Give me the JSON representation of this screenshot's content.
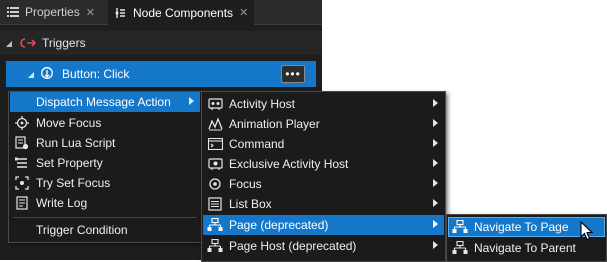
{
  "tabs": [
    {
      "label": "Properties",
      "icon": "list-icon",
      "close": "✕"
    },
    {
      "label": "Node Components",
      "icon": "node-components-icon",
      "close": "✕"
    }
  ],
  "tree": {
    "triggers_label": "Triggers",
    "button_label": "Button: Click",
    "more_label": "•••"
  },
  "menu1": {
    "items": [
      {
        "label": "Dispatch Message Action",
        "icon": "",
        "submenu": true
      },
      {
        "label": "Move Focus",
        "icon": "move-focus-icon"
      },
      {
        "label": "Run Lua Script",
        "icon": "lua-script-icon"
      },
      {
        "label": "Set Property",
        "icon": "set-property-icon"
      },
      {
        "label": "Try Set Focus",
        "icon": "try-set-focus-icon"
      },
      {
        "label": "Write Log",
        "icon": "write-log-icon"
      }
    ],
    "trigger_condition": "Trigger Condition"
  },
  "menu2": {
    "items": [
      {
        "label": "Activity Host",
        "icon": "activity-host-icon"
      },
      {
        "label": "Animation Player",
        "icon": "animation-player-icon"
      },
      {
        "label": "Command",
        "icon": "command-icon"
      },
      {
        "label": "Exclusive Activity Host",
        "icon": "exclusive-activity-host-icon"
      },
      {
        "label": "Focus",
        "icon": "focus-icon"
      },
      {
        "label": "List Box",
        "icon": "list-box-icon"
      },
      {
        "label": "Page (deprecated)",
        "icon": "page-icon"
      },
      {
        "label": "Page Host (deprecated)",
        "icon": "page-host-icon"
      }
    ]
  },
  "menu3": {
    "items": [
      {
        "label": "Navigate To Page",
        "icon": "navigate-icon"
      },
      {
        "label": "Navigate To Parent",
        "icon": "navigate-icon"
      }
    ]
  },
  "colors": {
    "accent": "#1577c9",
    "background": "#1e1e1e",
    "menu_bg": "#1b1b1b"
  }
}
